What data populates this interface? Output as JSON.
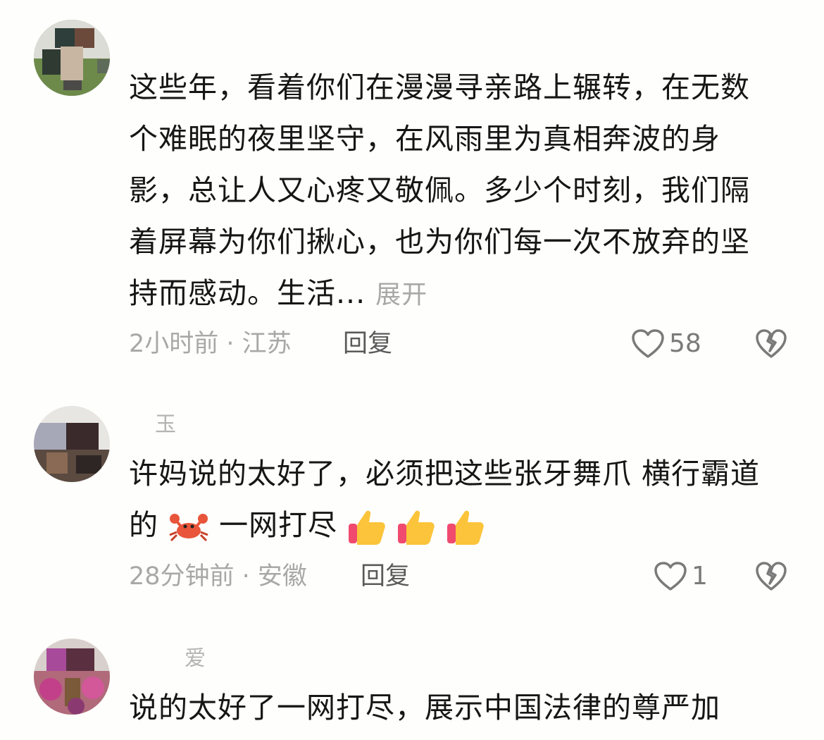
{
  "comments": [
    {
      "username": "",
      "text": "这些年，看着你们在漫漫寻亲路上辗转，在无数个难眠的夜里坚守，在风雨里为真相奔波的身影，总让人又心疼又敬佩。多少个时刻，我们隔着屏幕为你们揪心，也为你们每一次不放弃的坚持而感动。生活...",
      "expand_label": "展开",
      "meta": "2小时前 · 江苏",
      "reply_label": "回复",
      "likes": "58"
    },
    {
      "username": "玉",
      "text_before": "许妈说的太好了，必须把这些张牙舞爪 横行霸道的",
      "text_after": "一网打尽",
      "meta": "28分钟前 · 安徽",
      "reply_label": "回复",
      "likes": "1"
    },
    {
      "username": "爱",
      "text": "说的太好了一网打尽，展示中国法律的尊严加"
    }
  ],
  "icons": {
    "like": "heart-outline-icon",
    "dislike": "broken-heart-icon",
    "crab": "crab-emoji",
    "thumbs_up": "thumbs-up-emoji"
  },
  "colors": {
    "text": "#161616",
    "meta": "#a8a8a8",
    "reply": "#5a5a5a"
  }
}
